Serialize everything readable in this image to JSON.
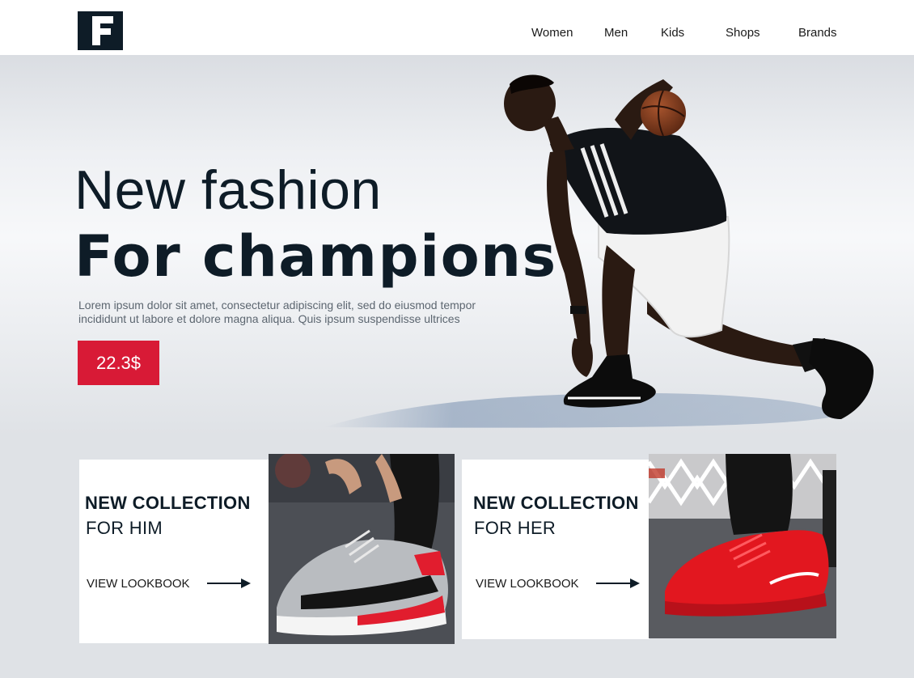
{
  "brand": {
    "logo_letter": "F"
  },
  "nav": {
    "items": [
      "Women",
      "Men",
      "Kids",
      "Shops",
      "Brands"
    ]
  },
  "hero": {
    "headline_line1": "New fashion",
    "headline_line2": "For champions",
    "description": "Lorem ipsum dolor sit amet, consectetur adipiscing elit, sed do eiusmod tempor incididunt ut labore et dolore magna aliqua. Quis ipsum suspendisse ultrices",
    "price": "22.3$"
  },
  "collections": [
    {
      "title": "NEW COLLECTION",
      "subtitle": "FOR HIM",
      "link": "VIEW LOOKBOOK"
    },
    {
      "title": "NEW COLLECTION",
      "subtitle": "FOR HER",
      "link": "VIEW LOOKBOOK"
    }
  ],
  "colors": {
    "accent": "#d81a36",
    "dark": "#0e1c27",
    "background": "#dfe2e6"
  }
}
